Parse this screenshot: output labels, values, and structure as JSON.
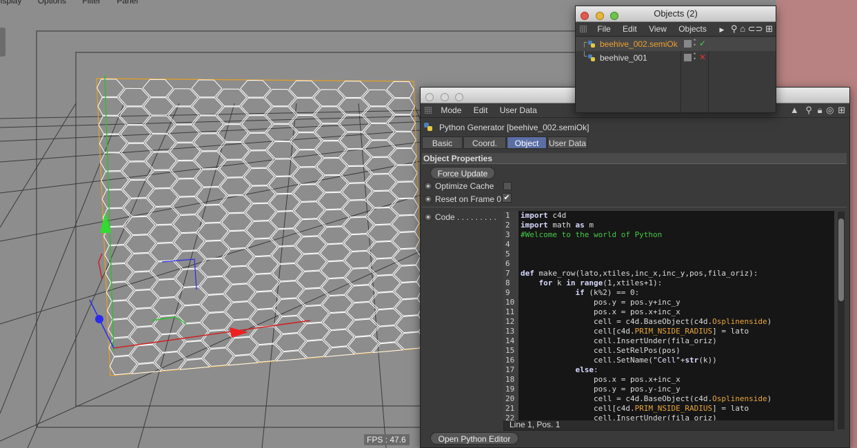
{
  "viewport": {
    "menu": [
      "Display",
      "Options",
      "Filter",
      "Panel"
    ],
    "fps": "FPS : 47.6"
  },
  "objects_window": {
    "title": "Objects (2)",
    "menu": [
      "File",
      "Edit",
      "View",
      "Objects"
    ],
    "items": [
      {
        "name": "beehive_002.semiOk",
        "status": "check",
        "color": "#f0a030"
      },
      {
        "name": "beehive_001",
        "status": "cross",
        "color": "#dddddd"
      }
    ]
  },
  "attributes_window": {
    "menu": [
      "Mode",
      "Edit",
      "User Data"
    ],
    "object_title": "Python Generator [beehive_002.semiOk]",
    "tabs": [
      {
        "label": "Basic",
        "active": false
      },
      {
        "label": "Coord.",
        "active": false
      },
      {
        "label": "Object",
        "active": true
      },
      {
        "label": "User Data",
        "active": false
      }
    ],
    "section_title": "Object Properties",
    "force_update_label": "Force Update",
    "optimize_cache_label": "Optimize Cache",
    "optimize_cache_checked": false,
    "reset_frame_label": "Reset on Frame 0",
    "reset_frame_checked": true,
    "code_label": "Code . . . . . . . . .",
    "code_status": "Line 1, Pos. 1",
    "open_editor_label": "Open Python Editor",
    "code_lines": [
      "import c4d",
      "import math as m",
      "#Welcome to the world of Python",
      "",
      "",
      "",
      "def make_row(lato,xtiles,inc_x,inc_y,pos,fila_oriz):",
      "    for k in range(1,xtiles+1):",
      "            if (k%2) == 0:",
      "                pos.y = pos.y+inc_y",
      "                pos.x = pos.x+inc_x",
      "                cell = c4d.BaseObject(c4d.Osplinenside)",
      "                cell[c4d.PRIM_NSIDE_RADIUS] = lato",
      "                cell.InsertUnder(fila_oriz)",
      "                cell.SetRelPos(pos)",
      "                cell.SetName(\"Cell\"+str(k))",
      "            else:",
      "                pos.x = pos.x+inc_x",
      "                pos.y = pos.y-inc_y",
      "                cell = c4d.BaseObject(c4d.Osplinenside)",
      "                cell[c4d.PRIM_NSIDE_RADIUS] = lato",
      "                cell.InsertUnder(fila_oriz)"
    ]
  }
}
